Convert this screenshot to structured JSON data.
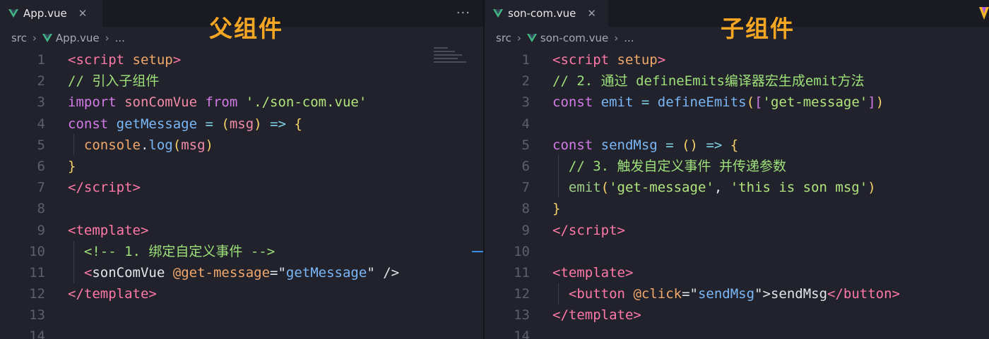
{
  "left": {
    "tab": {
      "label": "App.vue",
      "close": "✕"
    },
    "more": "···",
    "breadcrumb": {
      "folder": "src",
      "file": "App.vue",
      "tail": "..."
    },
    "heading": "父组件",
    "line_numbers": [
      "1",
      "2",
      "3",
      "4",
      "5",
      "6",
      "7",
      "8",
      "9",
      "10",
      "11",
      "12",
      "13",
      "14"
    ],
    "lines": [
      [
        [
          "tag",
          "<"
        ],
        [
          "tag",
          "script"
        ],
        [
          "plain",
          " "
        ],
        [
          "attr",
          "setup"
        ],
        [
          "tag",
          ">"
        ]
      ],
      [
        [
          "com",
          "// 引入子组件"
        ]
      ],
      [
        [
          "kw",
          "import"
        ],
        [
          "plain",
          " "
        ],
        [
          "var",
          "sonComVue"
        ],
        [
          "plain",
          " "
        ],
        [
          "kw",
          "from"
        ],
        [
          "plain",
          " "
        ],
        [
          "str",
          "'./son-com.vue'"
        ]
      ],
      [
        [
          "kw",
          "const"
        ],
        [
          "plain",
          " "
        ],
        [
          "fn",
          "getMessage"
        ],
        [
          "plain",
          " "
        ],
        [
          "op",
          "="
        ],
        [
          "plain",
          " "
        ],
        [
          "brk",
          "("
        ],
        [
          "var",
          "msg"
        ],
        [
          "brk",
          ")"
        ],
        [
          "plain",
          " "
        ],
        [
          "op",
          "=>"
        ],
        [
          "plain",
          " "
        ],
        [
          "brk",
          "{"
        ]
      ],
      [
        [
          "plain",
          "  "
        ],
        [
          "attr",
          "console"
        ],
        [
          "plain",
          "."
        ],
        [
          "fn",
          "log"
        ],
        [
          "brk",
          "("
        ],
        [
          "var",
          "msg"
        ],
        [
          "brk",
          ")"
        ]
      ],
      [
        [
          "brk",
          "}"
        ]
      ],
      [
        [
          "tag",
          "</"
        ],
        [
          "tag",
          "script"
        ],
        [
          "tag",
          ">"
        ]
      ],
      [],
      [
        [
          "tag",
          "<"
        ],
        [
          "tag",
          "template"
        ],
        [
          "tag",
          ">"
        ]
      ],
      [
        [
          "plain",
          "  "
        ],
        [
          "com",
          "<!-- 1. 绑定自定义事件 -->"
        ]
      ],
      [
        [
          "plain",
          "  "
        ],
        [
          "tag",
          "<"
        ],
        [
          "plain",
          "sonComVue"
        ],
        [
          "plain",
          " "
        ],
        [
          "attr",
          "@get-message"
        ],
        [
          "plain",
          "=\""
        ],
        [
          "fn",
          "getMessage"
        ],
        [
          "plain",
          "\" />"
        ]
      ],
      [
        [
          "tag",
          "</"
        ],
        [
          "tag",
          "template"
        ],
        [
          "tag",
          ">"
        ]
      ],
      [],
      []
    ]
  },
  "right": {
    "tab": {
      "label": "son-com.vue",
      "close": "✕"
    },
    "breadcrumb": {
      "folder": "src",
      "file": "son-com.vue",
      "tail": "..."
    },
    "heading": "子组件",
    "line_numbers": [
      "1",
      "2",
      "3",
      "4",
      "5",
      "6",
      "7",
      "8",
      "9",
      "10",
      "11",
      "12",
      "13",
      "14"
    ],
    "lines": [
      [
        [
          "tag",
          "<"
        ],
        [
          "tag",
          "script"
        ],
        [
          "plain",
          " "
        ],
        [
          "attr",
          "setup"
        ],
        [
          "tag",
          ">"
        ]
      ],
      [
        [
          "com",
          "// 2. 通过 defineEmits编译器宏生成emit方法"
        ]
      ],
      [
        [
          "kw",
          "const"
        ],
        [
          "plain",
          " "
        ],
        [
          "fn",
          "emit"
        ],
        [
          "plain",
          " "
        ],
        [
          "op",
          "="
        ],
        [
          "plain",
          " "
        ],
        [
          "fn",
          "defineEmits"
        ],
        [
          "brk",
          "("
        ],
        [
          "kw",
          "["
        ],
        [
          "str",
          "'get-message'"
        ],
        [
          "kw",
          "]"
        ],
        [
          "brk",
          ")"
        ]
      ],
      [],
      [
        [
          "kw",
          "const"
        ],
        [
          "plain",
          " "
        ],
        [
          "fn",
          "sendMsg"
        ],
        [
          "plain",
          " "
        ],
        [
          "op",
          "="
        ],
        [
          "plain",
          " "
        ],
        [
          "brk",
          "()"
        ],
        [
          "plain",
          " "
        ],
        [
          "op",
          "=>"
        ],
        [
          "plain",
          " "
        ],
        [
          "brk",
          "{"
        ]
      ],
      [
        [
          "plain",
          "  "
        ],
        [
          "com",
          "// 3. 触发自定义事件 并传递参数"
        ]
      ],
      [
        [
          "plain",
          "  "
        ],
        [
          "fnc",
          "emit"
        ],
        [
          "brk",
          "("
        ],
        [
          "str",
          "'get-message'"
        ],
        [
          "plain",
          ", "
        ],
        [
          "str",
          "'this is son msg'"
        ],
        [
          "brk",
          ")"
        ]
      ],
      [
        [
          "brk",
          "}"
        ]
      ],
      [
        [
          "tag",
          "</"
        ],
        [
          "tag",
          "script"
        ],
        [
          "tag",
          ">"
        ]
      ],
      [],
      [
        [
          "tag",
          "<"
        ],
        [
          "tag",
          "template"
        ],
        [
          "tag",
          ">"
        ]
      ],
      [
        [
          "plain",
          "  "
        ],
        [
          "tag",
          "<"
        ],
        [
          "tag",
          "button"
        ],
        [
          "plain",
          " "
        ],
        [
          "attr",
          "@click"
        ],
        [
          "plain",
          "=\""
        ],
        [
          "fn",
          "sendMsg"
        ],
        [
          "plain",
          "\">"
        ],
        [
          "plain",
          "sendMsg"
        ],
        [
          "tag",
          "</"
        ],
        [
          "tag",
          "button"
        ],
        [
          "tag",
          ">"
        ]
      ],
      [
        [
          "tag",
          "</"
        ],
        [
          "tag",
          "template"
        ],
        [
          "tag",
          ">"
        ]
      ],
      []
    ]
  },
  "colors": {
    "accent_heading": "#f5a623",
    "vue_green": "#41b883",
    "vue_dark": "#35495e"
  }
}
